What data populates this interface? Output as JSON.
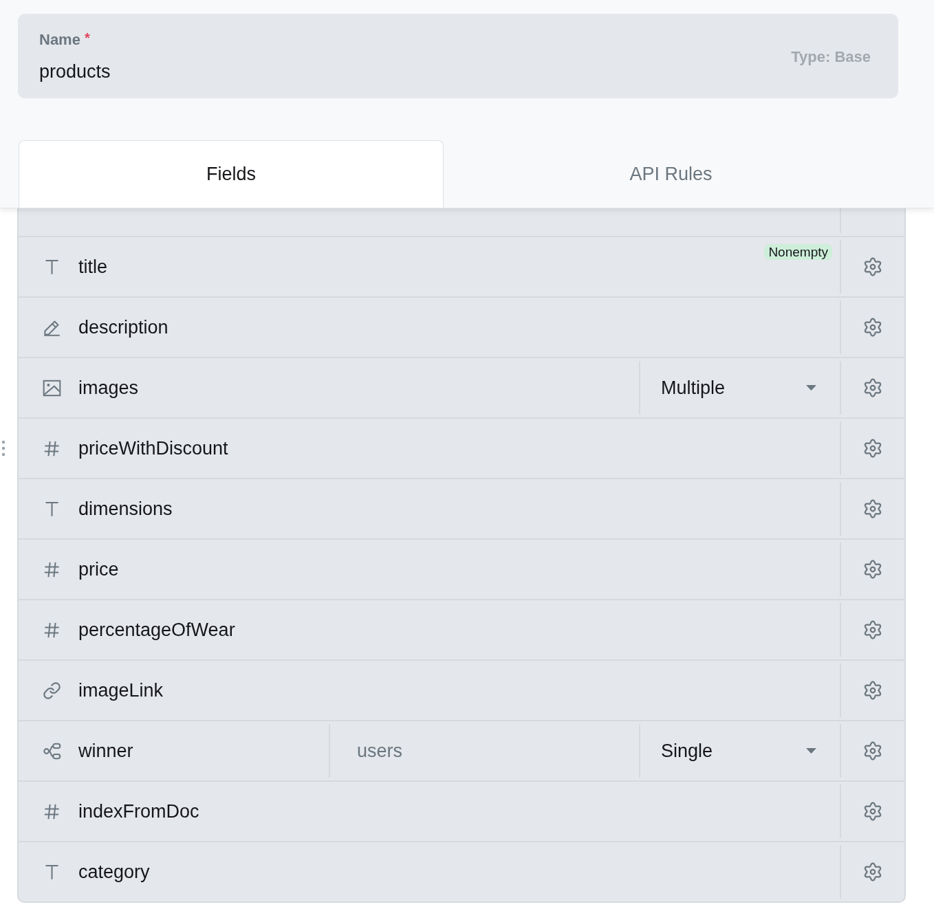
{
  "collection_form": {
    "label": "Name",
    "required_mark": "*",
    "value": "products",
    "type": "Type: Base"
  },
  "tabs": [
    {
      "label": "Fields",
      "selected": true
    },
    {
      "label": "API Rules",
      "selected": false
    }
  ],
  "fields": [
    {
      "kind": "text",
      "name": "title",
      "badge": "Nonempty",
      "hovered": false
    },
    {
      "kind": "editor",
      "name": "description",
      "hovered": false
    },
    {
      "kind": "file",
      "name": "images",
      "select": "Multiple",
      "hovered": false
    },
    {
      "kind": "number",
      "name": "priceWithDiscount",
      "hovered": true
    },
    {
      "kind": "text",
      "name": "dimensions",
      "hovered": false
    },
    {
      "kind": "number",
      "name": "price",
      "hovered": false
    },
    {
      "kind": "number",
      "name": "percentageOfWear",
      "hovered": false
    },
    {
      "kind": "url",
      "name": "imageLink",
      "hovered": false
    },
    {
      "kind": "relation",
      "name": "winner",
      "collection": "users",
      "select": "Single",
      "hovered": false
    },
    {
      "kind": "number",
      "name": "indexFromDoc",
      "hovered": false
    },
    {
      "kind": "text",
      "name": "category",
      "hovered": false
    }
  ]
}
